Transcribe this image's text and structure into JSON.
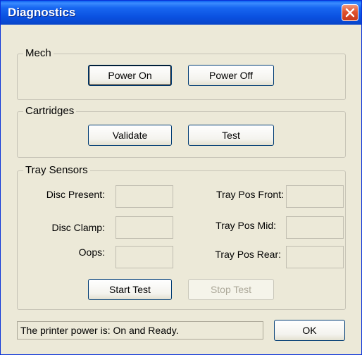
{
  "window": {
    "title": "Diagnostics"
  },
  "mech": {
    "label": "Mech",
    "power_on": "Power On",
    "power_off": "Power Off"
  },
  "cartridges": {
    "label": "Cartridges",
    "validate": "Validate",
    "test": "Test"
  },
  "tray_sensors": {
    "label": "Tray Sensors",
    "disc_present": "Disc Present:",
    "disc_clamp": "Disc Clamp:",
    "oops": "Oops:",
    "tray_pos_front": "Tray Pos Front:",
    "tray_pos_mid": "Tray Pos Mid:",
    "tray_pos_rear": "Tray Pos Rear:",
    "start_test": "Start Test",
    "stop_test": "Stop Test"
  },
  "footer": {
    "status": "The printer power is: On and Ready.",
    "ok": "OK"
  },
  "colors": {
    "titlebar": "#0a50e0",
    "window_bg": "#ece9d8",
    "close": "#e0522c"
  },
  "icons": {
    "close": "close-icon"
  }
}
